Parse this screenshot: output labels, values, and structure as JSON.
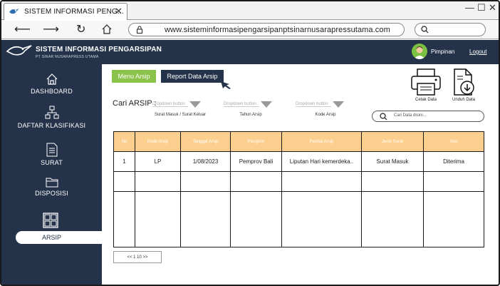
{
  "browser": {
    "tab_title": "SISTEM INFORMASI PENG...",
    "url": "www.sisteminformasipengarsipanptsinarnusarapressutama.com",
    "window_controls": [
      "—",
      "☐",
      "✕"
    ]
  },
  "app": {
    "title": "SISTEM INFORMASI PENGARSIPAN",
    "subtitle": "PT SINAR NUSARAPRESS UTAMA",
    "user": "Pimpinan",
    "logout": "Logout"
  },
  "sidebar": {
    "items": [
      {
        "label": "DASHBOARD",
        "icon": "home-icon"
      },
      {
        "label": "DAFTAR KLASIFIKASI",
        "icon": "org-chart-icon"
      },
      {
        "label": "SURAT",
        "icon": "document-icon"
      },
      {
        "label": "DISPOSISI",
        "icon": "folder-icon"
      },
      {
        "label": "ARSIP",
        "icon": "archive-cabinet-icon",
        "active": true
      }
    ]
  },
  "main": {
    "tabs": {
      "menu": "Menu Arsip",
      "report": "Report Data Arsip"
    },
    "actions": {
      "print": "Cetak Data",
      "download": "Unduh Data"
    },
    "filter_label": "Cari ARSIP :",
    "dropdowns": [
      {
        "text": "Dropdown button",
        "caption": "Surat Masuk / Surat Keluar"
      },
      {
        "text": "Dropdown button",
        "caption": "Tahun Arsip"
      },
      {
        "text": "Dropdown button",
        "caption": "Kode Arsip"
      }
    ],
    "search_placeholder": "Cari Data disini...",
    "table": {
      "headers": [
        "No",
        "Kode Arsip",
        "Tanggal Arsip",
        "Pengirim",
        "Perihal Arsip",
        "Jenis Surat",
        "Aksi"
      ],
      "rows": [
        [
          "1",
          "LP",
          "1/08/2023",
          "Pemprov Bali",
          "Liputan Hari kemerdeka..",
          "Surat Masuk",
          "Diterima"
        ]
      ]
    },
    "pagination": "<< 1  10 >>"
  },
  "colors": {
    "header_bg": "#243349",
    "accent_green": "#8bc34a",
    "table_header": "#fccf8e"
  }
}
